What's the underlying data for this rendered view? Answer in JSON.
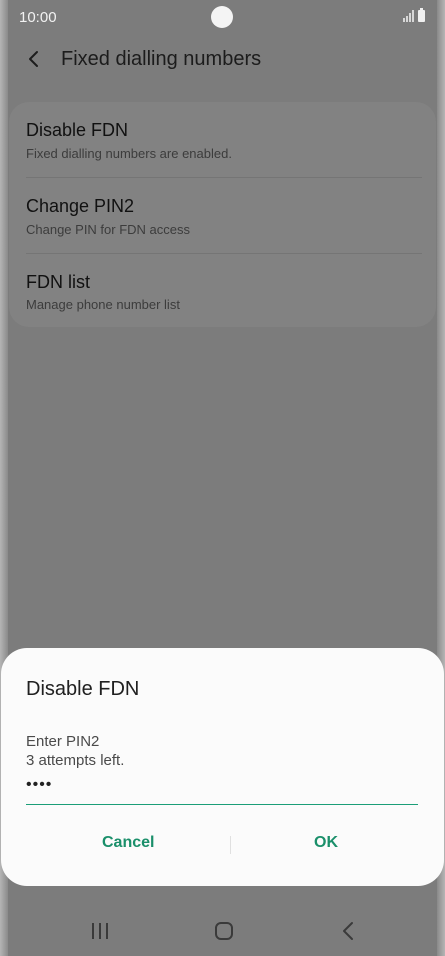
{
  "status_bar": {
    "time": "10:00"
  },
  "app_bar": {
    "title": "Fixed dialling numbers",
    "back_icon": "chevron-left-icon"
  },
  "settings": {
    "items": [
      {
        "title": "Disable FDN",
        "subtitle": "Fixed dialling numbers are enabled."
      },
      {
        "title": "Change PIN2",
        "subtitle": "Change PIN for FDN access"
      },
      {
        "title": "FDN list",
        "subtitle": "Manage phone number list"
      }
    ]
  },
  "dialog": {
    "title": "Disable FDN",
    "message_line1": "Enter PIN2",
    "message_line2": "3 attempts left.",
    "pin_value": "••••",
    "cancel_label": "Cancel",
    "ok_label": "OK",
    "accent_color": "#1a8f6a"
  },
  "nav_bar": {
    "icons": [
      "recents-icon",
      "home-icon",
      "back-icon"
    ]
  }
}
